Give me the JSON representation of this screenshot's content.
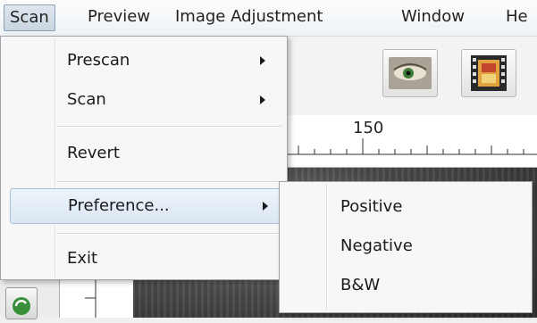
{
  "menubar": {
    "items": [
      {
        "label": "Scan",
        "active": true
      },
      {
        "label": "Preview",
        "active": false
      },
      {
        "label": "Image Adjustment",
        "active": false
      },
      {
        "label": "Window",
        "active": false
      },
      {
        "label": "He",
        "active": false
      }
    ]
  },
  "scan_menu": {
    "items": [
      {
        "label": "Prescan",
        "has_submenu": true
      },
      {
        "label": "Scan",
        "has_submenu": true
      },
      {
        "label": "Revert",
        "has_submenu": false
      },
      {
        "label": "Preference...",
        "has_submenu": true,
        "highlighted": true
      },
      {
        "label": "Exit",
        "has_submenu": false
      }
    ]
  },
  "preference_submenu": {
    "items": [
      {
        "label": "Positive"
      },
      {
        "label": "Negative"
      },
      {
        "label": "B&W"
      }
    ]
  },
  "toolbar": {
    "buttons": [
      {
        "icon": "eye-icon"
      },
      {
        "icon": "film-strip-icon"
      }
    ]
  },
  "ruler": {
    "label": "150"
  },
  "colors": {
    "menu_highlight": "#dbe7f3",
    "menu_border": "#9da3aa"
  }
}
